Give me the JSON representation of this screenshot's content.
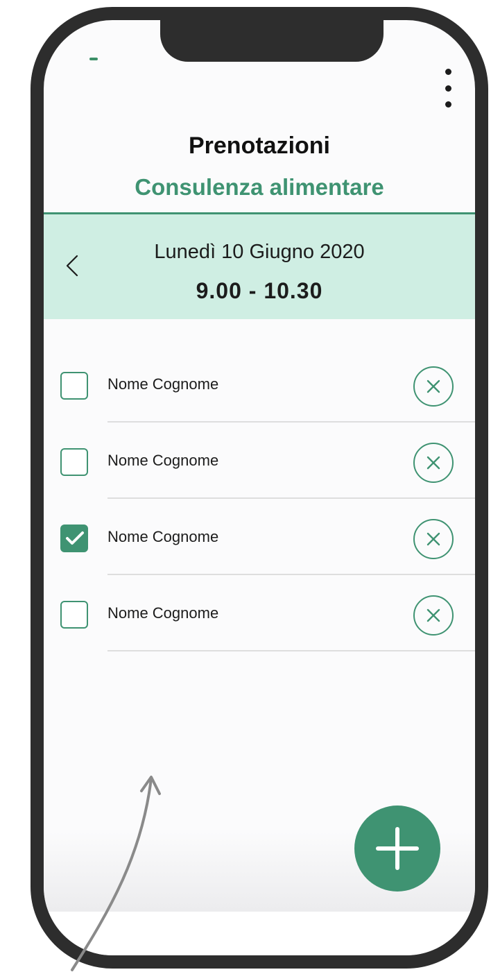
{
  "header": {
    "title": "Prenotazioni",
    "subtitle": "Consulenza alimentare"
  },
  "slot": {
    "date": "Lunedì 10 Giugno 2020",
    "time": "9.00 - 10.30"
  },
  "bookings": [
    {
      "name": "Nome Cognome",
      "checked": false
    },
    {
      "name": "Nome Cognome",
      "checked": false
    },
    {
      "name": "Nome Cognome",
      "checked": true
    },
    {
      "name": "Nome Cognome",
      "checked": false
    }
  ],
  "icons": {
    "menu": "more-vertical-icon",
    "back": "chevron-left-icon",
    "remove": "close-circle-icon",
    "add": "plus-icon"
  },
  "colors": {
    "accent": "#3f9372",
    "band": "#cfeee3",
    "frame": "#2d2d2d"
  }
}
